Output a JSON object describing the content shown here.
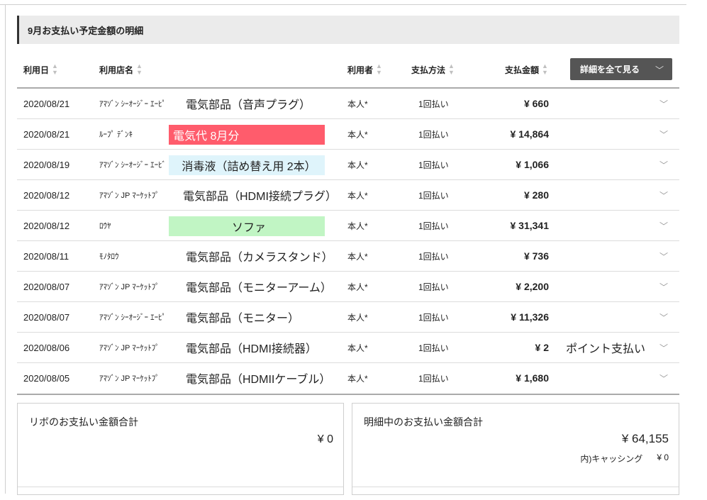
{
  "section": {
    "title": "9月お支払い予定金額の明細"
  },
  "table": {
    "headers": {
      "date": "利用日",
      "store": "利用店名",
      "user": "利用者",
      "method": "支払方法",
      "amount": "支払金額"
    },
    "detail_button": "詳細を全て見る",
    "rows": [
      {
        "date": "2020/08/21",
        "store": "ｱﾏｿﾞﾝ ｼｰｵｰｼﾞｰ ｴｰﾋﾟ",
        "note": "電気部品（音声プラグ）",
        "note_highlight": "",
        "user": "本人*",
        "method": "1回払い",
        "amount": "¥ 660",
        "extra": ""
      },
      {
        "date": "2020/08/21",
        "store": "ﾙｰﾌﾟ ﾃﾞﾝｷ",
        "note": "電気代 8月分",
        "note_highlight": "#ff5c6c",
        "user": "本人*",
        "method": "1回払い",
        "amount": "¥ 14,864",
        "extra": ""
      },
      {
        "date": "2020/08/19",
        "store": "ｱﾏｿﾞﾝ ｼｰｵｰｼﾞｰ ｴｰﾋﾞ",
        "note": "消毒液（詰め替え用 2本）",
        "note_highlight": "#dff4fb",
        "user": "本人*",
        "method": "1回払い",
        "amount": "¥ 1,066",
        "extra": ""
      },
      {
        "date": "2020/08/12",
        "store": "ｱﾏｿﾞﾝ JP ﾏｰｹｯﾄﾌﾟ",
        "note": "電気部品（HDMI接続プラグ）",
        "note_highlight": "",
        "user": "本人*",
        "method": "1回払い",
        "amount": "¥ 280",
        "extra": ""
      },
      {
        "date": "2020/08/12",
        "store": "ﾛｳﾔ",
        "note": "ソファ",
        "note_highlight": "#c1f5c4",
        "user": "本人*",
        "method": "1回払い",
        "amount": "¥ 31,341",
        "extra": ""
      },
      {
        "date": "2020/08/11",
        "store": "ﾓﾉﾀﾛｳ",
        "note": "電気部品（カメラスタンド）",
        "note_highlight": "",
        "user": "本人*",
        "method": "1回払い",
        "amount": "¥ 736",
        "extra": ""
      },
      {
        "date": "2020/08/07",
        "store": "ｱﾏｿﾞﾝ JP ﾏｰｹｯﾄﾌﾟ",
        "note": "電気部品（モニターアーム）",
        "note_highlight": "",
        "user": "本人*",
        "method": "1回払い",
        "amount": "¥ 2,200",
        "extra": ""
      },
      {
        "date": "2020/08/07",
        "store": "ｱﾏｿﾞﾝ ｼｰｵｰｼﾞｰ ｴｰﾋﾟ",
        "note": "電気部品（モニター）",
        "note_highlight": "",
        "user": "本人*",
        "method": "1回払い",
        "amount": "¥ 11,326",
        "extra": ""
      },
      {
        "date": "2020/08/06",
        "store": "ｱﾏｿﾞﾝ JP ﾏｰｹｯﾄﾌﾟ",
        "note": "電気部品（HDMI接続器）",
        "note_highlight": "",
        "user": "本人*",
        "method": "1回払い",
        "amount": "¥ 2",
        "extra": "ポイント支払い"
      },
      {
        "date": "2020/08/05",
        "store": "ｱﾏｿﾞﾝ JP ﾏｰｹｯﾄﾌﾟ",
        "note": "電気部品（HDMIIケーブル）",
        "note_highlight": "",
        "user": "本人*",
        "method": "1回払い",
        "amount": "¥ 1,680",
        "extra": ""
      }
    ]
  },
  "summary": {
    "revolving": {
      "title": "リボのお支払い金額合計",
      "amount": "¥ 0"
    },
    "statement": {
      "title": "明細中のお支払い金額合計",
      "amount": "¥ 64,155",
      "cashing_label": "内)キャッシング",
      "cashing_amount": "¥ 0"
    }
  },
  "icons": {
    "sort": "sort-icon",
    "expand": "chevron-down-icon"
  }
}
